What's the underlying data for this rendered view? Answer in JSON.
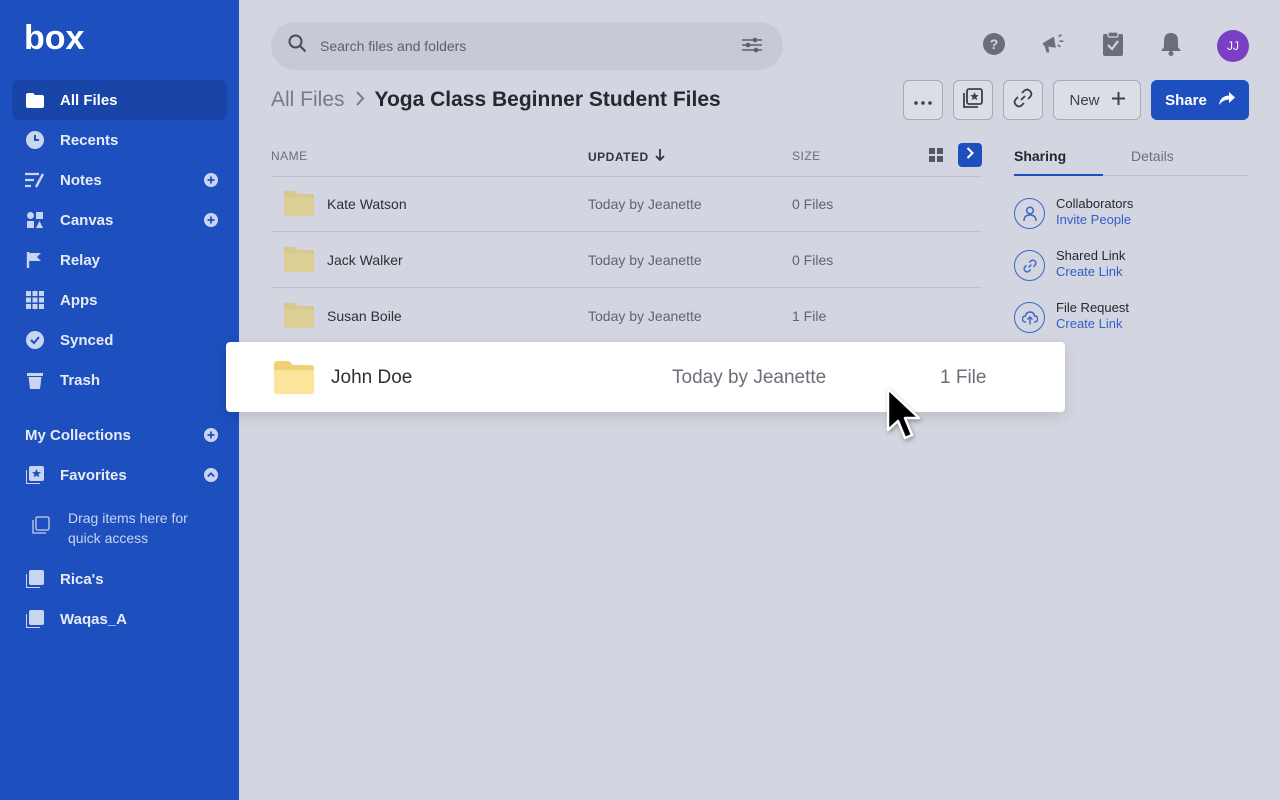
{
  "sidebar": {
    "logo_text": "box",
    "items": [
      {
        "label": "All Files",
        "icon": "folder-icon"
      },
      {
        "label": "Recents",
        "icon": "clock-icon"
      },
      {
        "label": "Notes",
        "icon": "notes-icon"
      },
      {
        "label": "Canvas",
        "icon": "canvas-icon"
      },
      {
        "label": "Relay",
        "icon": "relay-icon"
      },
      {
        "label": "Apps",
        "icon": "apps-grid-icon"
      },
      {
        "label": "Synced",
        "icon": "check-circle-icon"
      },
      {
        "label": "Trash",
        "icon": "trash-icon"
      }
    ],
    "collections_label": "My Collections",
    "favorites_label": "Favorites",
    "drag_hint": "Drag items here for quick access",
    "collections": [
      {
        "label": "Rica's"
      },
      {
        "label": "Waqas_A"
      }
    ]
  },
  "header": {
    "search_placeholder": "Search files and folders",
    "avatar_initials": "JJ"
  },
  "breadcrumb": {
    "root": "All Files",
    "separator": ">",
    "current": "Yoga Class Beginner Student Files"
  },
  "toolbar": {
    "more_label": "···",
    "new_label": "New",
    "share_label": "Share"
  },
  "table": {
    "columns": {
      "name": "NAME",
      "updated": "UPDATED",
      "size": "SIZE"
    },
    "rows": [
      {
        "name": "Kate Watson",
        "updated": "Today by Jeanette",
        "size": "0 Files"
      },
      {
        "name": "Jack Walker",
        "updated": "Today by Jeanette",
        "size": "0 Files"
      },
      {
        "name": "Susan Boile",
        "updated": "Today by Jeanette",
        "size": "1 File"
      }
    ],
    "dragging_row": {
      "name": "John Doe",
      "updated": "Today by Jeanette",
      "size": "1 File"
    }
  },
  "panel": {
    "tabs": [
      "Sharing",
      "Details"
    ],
    "options": [
      {
        "title": "Collaborators",
        "link": "Invite People",
        "icon": "person-icon"
      },
      {
        "title": "Shared Link",
        "link": "Create Link",
        "icon": "link-icon"
      },
      {
        "title": "File Request",
        "link": "Create Link",
        "icon": "upload-cloud-icon"
      }
    ]
  },
  "colors": {
    "sidebar_bg": "#1e4fbf",
    "accent": "#1e4fbf",
    "folder": "#f3d98a"
  }
}
